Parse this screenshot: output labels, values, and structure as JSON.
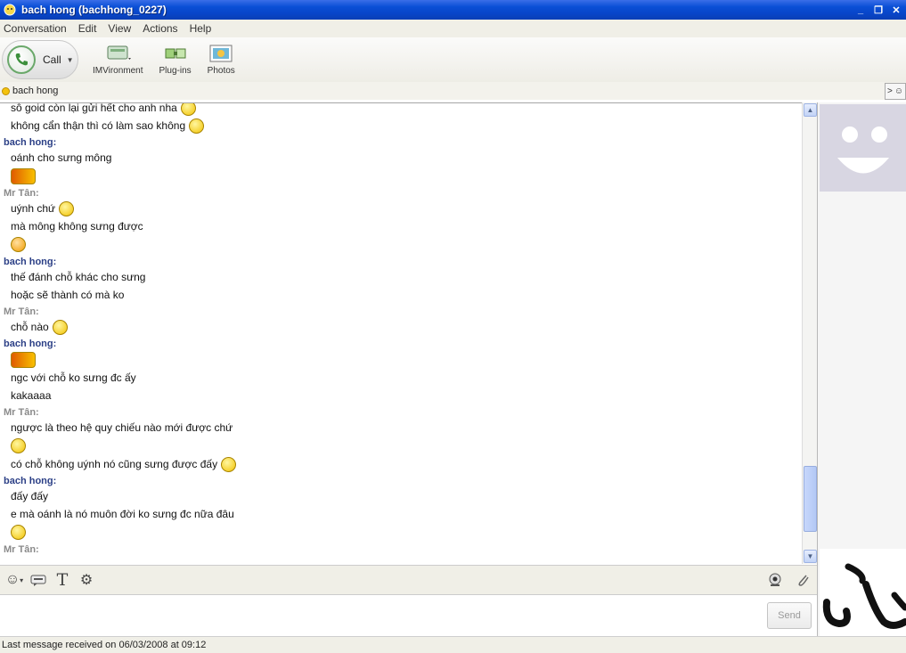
{
  "window": {
    "title": "bach hong (bachhong_0227)"
  },
  "menu": [
    "Conversation",
    "Edit",
    "View",
    "Actions",
    "Help"
  ],
  "toolbar": {
    "call_label": "Call",
    "imvironment_label": "IMVironment",
    "plugins_label": "Plug-ins",
    "photos_label": "Photos"
  },
  "contact": {
    "name": "bach hong",
    "status_color": "#f4c20d"
  },
  "colors": {
    "bach_sender": "#2b3f86",
    "tan_sender": "#8a8a8a",
    "title_bar": "#0a4fd6"
  },
  "messages": {
    "g0": {
      "l0": "sô goid còn lại gửi hết cho anh nha",
      "l1": "không cẩn thận thì có làm sao không"
    },
    "g1": {
      "sender": "bach hong:",
      "l0": "oánh cho sưng mông"
    },
    "g2": {
      "sender": "Mr Tân:",
      "l0": "uýnh chứ",
      "l1": "mà mông không sưng được"
    },
    "g3": {
      "sender": "bach hong:",
      "l0": "thế đánh chỗ khác cho sưng",
      "l1": "hoặc sẽ thành có mà ko"
    },
    "g4": {
      "sender": "Mr Tân:",
      "l0": "chỗ nào"
    },
    "g5": {
      "sender": "bach hong:",
      "l0": "ngc với chỗ ko sưng đc ấy",
      "l1": "kakaaaa"
    },
    "g6": {
      "sender": "Mr Tân:",
      "l0": "ngược là theo hệ quy chiếu nào mới được chứ",
      "l1": "có chỗ không uýnh nó cũng sưng được đấy"
    },
    "g7": {
      "sender": "bach hong:",
      "l0": "đấy đấy",
      "l1": "e mà oánh là nó muôn đời ko sưng đc nữa đâu"
    },
    "g8": {
      "sender": "Mr Tân:"
    }
  },
  "send_label": "Send",
  "status": "Last message received on 06/03/2008 at 09:12",
  "icons": [
    "messenger-icon",
    "minimize-icon",
    "restore-icon",
    "close-icon",
    "phone-icon",
    "imvironment-icon",
    "plugins-icon",
    "photos-icon",
    "emoticon-picker-icon",
    "nudge-icon",
    "font-icon",
    "audibles-icon",
    "webcam-icon",
    "attach-icon"
  ]
}
